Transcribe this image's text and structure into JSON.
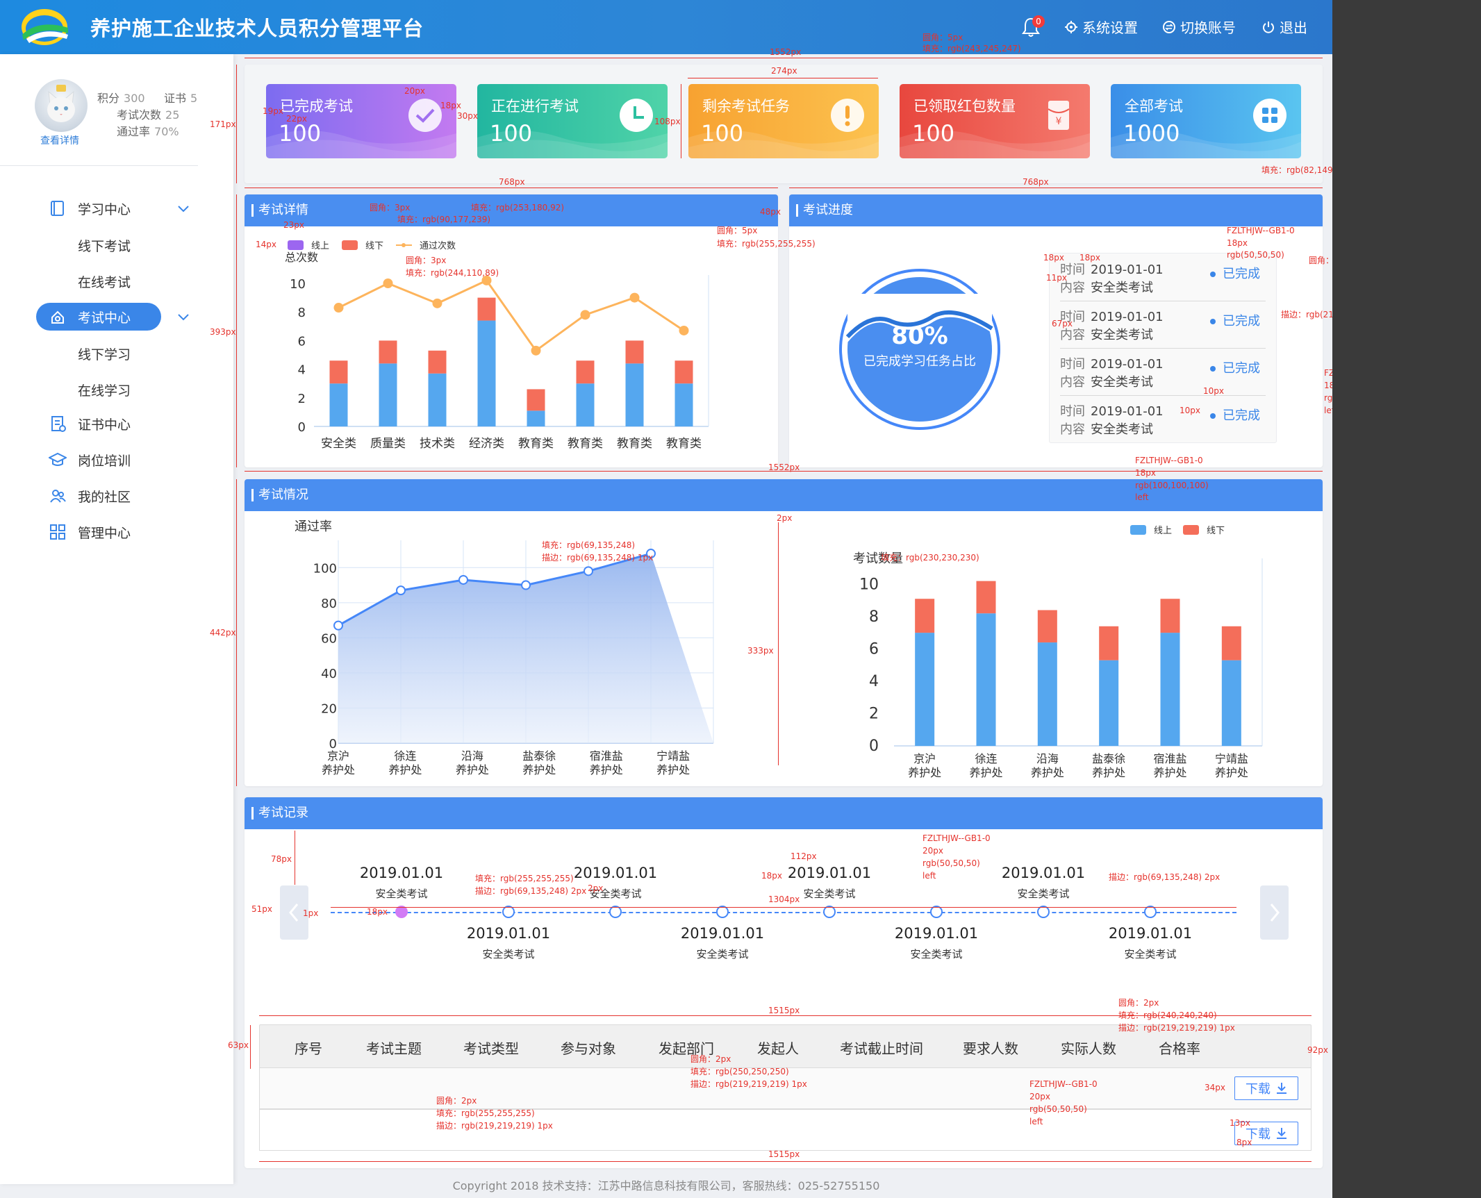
{
  "header": {
    "title": "养护施工企业技术人员积分管理平台",
    "badge": "0",
    "settings": "系统设置",
    "switch_account": "切换账号",
    "logout": "退出"
  },
  "profile": {
    "points_label": "积分",
    "points": "300",
    "cert_label": "证书",
    "cert": "5",
    "exams_label": "考试次数",
    "exams": "25",
    "pass_label": "通过率",
    "pass": "70%",
    "view_detail": "查看详情"
  },
  "nav": [
    {
      "label": "学习中心",
      "icon": "book-icon",
      "expanded": true,
      "children": [
        "线下考试",
        "在线考试"
      ]
    },
    {
      "label": "考试中心",
      "icon": "exam-icon",
      "active": true,
      "expanded": true,
      "children": [
        "线下学习",
        "在线学习"
      ]
    },
    {
      "label": "证书中心",
      "icon": "certificate-icon"
    },
    {
      "label": "岗位培训",
      "icon": "graduation-cap-icon"
    },
    {
      "label": "我的社区",
      "icon": "community-icon"
    },
    {
      "label": "管理中心",
      "icon": "grid-icon"
    }
  ],
  "cards": [
    {
      "label": "已完成考试",
      "value": "100",
      "icon": "check-icon",
      "from": "#7c6cf0",
      "to": "#c37af0"
    },
    {
      "label": "正在进行考试",
      "value": "100",
      "icon": "clock-icon",
      "from": "#22b6a0",
      "to": "#4fd3a8"
    },
    {
      "label": "剩余考试任务",
      "value": "100",
      "icon": "exclamation-icon",
      "from": "#f7a231",
      "to": "#fcc24f"
    },
    {
      "label": "已领取红包数量",
      "value": "100",
      "icon": "red-envelope-icon",
      "from": "#e8473e",
      "to": "#f47a6e"
    },
    {
      "label": "全部考试",
      "value": "1000",
      "icon": "apps-icon",
      "from": "#3a8ee8",
      "to": "#5ac5f0"
    }
  ],
  "panels": {
    "detail": "考试详情",
    "progress": "考试进度",
    "situation": "考试情况",
    "records": "考试记录"
  },
  "progress": {
    "percent": "80%",
    "caption": "已完成学习任务占比",
    "time_label": "时间",
    "content_label": "内容",
    "items": [
      {
        "time": "2019-01-01",
        "content": "安全类考试",
        "status": "已完成"
      },
      {
        "time": "2019-01-01",
        "content": "安全类考试",
        "status": "已完成"
      },
      {
        "time": "2019-01-01",
        "content": "安全类考试",
        "status": "已完成"
      },
      {
        "time": "2019-01-01",
        "content": "安全类考试",
        "status": "已完成"
      }
    ]
  },
  "chart_data": [
    {
      "type": "bar",
      "ylabel": "总次数",
      "legend": [
        "线上",
        "线下",
        "通过次数"
      ],
      "categories": [
        "安全类",
        "质量类",
        "技术类",
        "经济类",
        "教育类",
        "教育类",
        "教育类",
        "教育类"
      ],
      "ylim": [
        0,
        10
      ],
      "yticks": [
        0,
        2,
        4,
        6,
        8,
        10
      ],
      "series": [
        {
          "name": "线上",
          "values": [
            3.0,
            4.4,
            3.7,
            7.4,
            1.1,
            3.0,
            4.4,
            3.0
          ],
          "color": "#55a7ef"
        },
        {
          "name": "线下",
          "values": [
            1.6,
            1.6,
            1.6,
            1.6,
            1.5,
            1.6,
            1.6,
            1.6
          ],
          "color": "#f46e5a"
        },
        {
          "name": "通过次数",
          "values": [
            8.3,
            10.0,
            8.6,
            10.2,
            5.3,
            7.8,
            9.0,
            6.7
          ],
          "color": "#fdb45c"
        }
      ]
    },
    {
      "type": "area",
      "ylabel": "通过率",
      "categories": [
        "京沪\n养护处",
        "徐连\n养护处",
        "沿海\n养护处",
        "盐泰徐\n养护处",
        "宿淮盐\n养护处",
        "宁靖盐\n养护处"
      ],
      "x": [
        0,
        1,
        2,
        3,
        4,
        5,
        6
      ],
      "ylim": [
        0,
        110
      ],
      "yticks": [
        0,
        20,
        40,
        60,
        80,
        100
      ],
      "series": [
        {
          "name": "通过率",
          "values": [
            67,
            87,
            93,
            90,
            98,
            108
          ],
          "color": "#4587f8"
        }
      ]
    },
    {
      "type": "bar",
      "ylabel": "考试数量",
      "legend": [
        "线上",
        "线下"
      ],
      "categories": [
        "京沪\n养护处",
        "徐连\n养护处",
        "沿海\n养护处",
        "盐泰徐\n养护处",
        "宿淮盐\n养护处",
        "宁靖盐\n养护处"
      ],
      "ylim": [
        0,
        11
      ],
      "yticks": [
        0,
        2,
        4,
        6,
        8,
        10
      ],
      "series": [
        {
          "name": "线上",
          "values": [
            7.0,
            8.2,
            6.4,
            5.3,
            7.0,
            5.3
          ],
          "color": "#55a7ef"
        },
        {
          "name": "线下",
          "values": [
            2.1,
            2.0,
            2.0,
            2.1,
            2.1,
            2.1
          ],
          "color": "#f46e5a"
        }
      ]
    }
  ],
  "timeline": {
    "top": [
      {
        "date": "2019.01.01",
        "name": "安全类考试"
      },
      {
        "date": "2019.01.01",
        "name": "安全类考试"
      },
      {
        "date": "2019.01.01",
        "name": "安全类考试"
      },
      {
        "date": "2019.01.01",
        "name": "安全类考试"
      }
    ],
    "bottom": [
      {
        "date": "2019.01.01",
        "name": "安全类考试"
      },
      {
        "date": "2019.01.01",
        "name": "安全类考试"
      },
      {
        "date": "2019.01.01",
        "name": "安全类考试"
      },
      {
        "date": "2019.01.01",
        "name": "安全类考试"
      }
    ]
  },
  "table": {
    "headers": [
      "序号",
      "考试主题",
      "考试类型",
      "参与对象",
      "发起部门",
      "发起人",
      "考试截止时间",
      "要求人数",
      "实际人数",
      "合格率"
    ],
    "download": "下载"
  },
  "footer": "Copyright 2018 技术支持：江苏中路信息科技有限公司，客服热线：025-52755150",
  "annotations": [
    "圆角：5px",
    "填充：rgb(243,245,247)",
    "1552px",
    "274px",
    "20px",
    "18px",
    "30px",
    "19px",
    "22px",
    "108px",
    "171px",
    "768px",
    "768px",
    "填充：rgb(82,149,240)",
    "48px",
    "圆角：3px",
    "填充：rgb(90,177,239)",
    "填充：rgb(253,180,92)",
    "23px",
    "14px",
    "圆角：3px",
    "填充：rgb(244,110,89)",
    "圆角：5px",
    "填充：rgb(255,255,255)",
    "393px",
    "FZLTHJW--GB1-0",
    "18px",
    "rgb(50,50,50)",
    "圆角：3px",
    "填充：rgb(249,249,249)",
    "描边：rgb(235,236,239)  1px",
    "18px",
    "18px",
    "11px",
    "67px",
    "描边：rgb(217,217,217)  1px",
    "FZLTHJW--GB1-0",
    "18px",
    "rgb(82,149,240)",
    "left",
    "10px",
    "10px",
    "FZLTHJW--GB1-0",
    "18px",
    "rgb(100,100,100)",
    "left",
    "1552px",
    "2px",
    "填充：rgb(69,135,248)",
    "描边：rgb(69,135,248)  1px",
    "填充：rgb(230,230,230)",
    "442px",
    "333px",
    "78px",
    "112px",
    "FZLTHJW--GB1-0",
    "20px",
    "rgb(50,50,50)",
    "left",
    "填充：rgb(255,255,255)",
    "描边：rgb(69,135,248)  2px",
    "2px",
    "18px",
    "1304px",
    "描边：rgb(69,135,248)  2px",
    "51px",
    "1px",
    "18px",
    "1515px",
    "圆角：2px",
    "填充：rgb(240,240,240)",
    "描边：rgb(219,219,219)  1px",
    "63px",
    "圆角：2px",
    "填充：rgb(250,250,250)",
    "描边：rgb(219,219,219)  1px",
    "FZLTHJW--GB1-0",
    "20px",
    "rgb(50,50,50)",
    "left",
    "92px",
    "圆角：2px",
    "填充：rgb(255,255,255)",
    "描边：rgb(69,135,248)  1px",
    "34px",
    "FZLTHJW--GB1-0",
    "18px",
    "rgb(69,135,248)",
    "left",
    "13px",
    "8px",
    "圆角：2px",
    "填充：rgb(255,255,255)",
    "描边：rgb(219,219,219)  1px",
    "1515px"
  ]
}
